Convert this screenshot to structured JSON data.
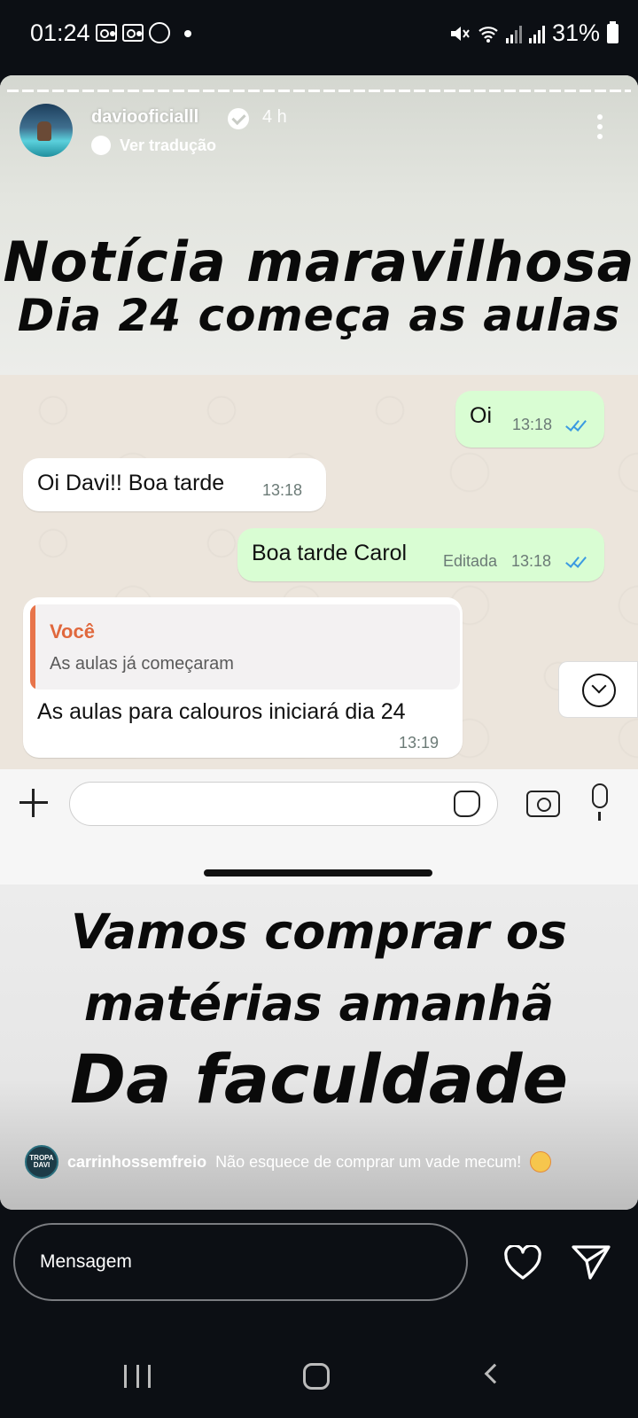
{
  "status_bar": {
    "time": "01:24",
    "battery": "31%"
  },
  "story": {
    "username": "daviooficialll",
    "time_ago": "4 h",
    "translate_label": "Ver tradução",
    "headline_line1": "Notícia maravilhosa",
    "headline_line2": "Dia 24 começa as aulas",
    "bottom_line1": "Vamos comprar os",
    "bottom_line2": "matérias amanhã",
    "bottom_line3": "Da faculdade",
    "reply": {
      "avatar_text": "TROPA DAVI",
      "user": "carrinhossemfreio",
      "text": "Não esquece de comprar um vade mecum!"
    }
  },
  "chat": {
    "messages": [
      {
        "text": "Oi",
        "time": "13:18",
        "status": ""
      },
      {
        "text": "Oi Davi!! Boa tarde",
        "time": "13:18",
        "status": ""
      },
      {
        "text": "Boa tarde Carol",
        "time": "13:18",
        "status": "Editada"
      },
      {
        "text": "As aulas para calouros iniciará dia 24",
        "time": "13:19",
        "status": "",
        "quote": {
          "author": "Você",
          "text": "As aulas já começaram"
        }
      }
    ]
  },
  "message_bar": {
    "placeholder": "Mensagem"
  },
  "colors": {
    "background": "#0c0f14",
    "outgoing_bubble": "#d9fdd3",
    "incoming_bubble": "#ffffff",
    "quote_accent": "#e0683d",
    "read_ticks": "#3b9ae1"
  },
  "icons": [
    "voicemail-icon",
    "whatsapp-icon",
    "mute-icon",
    "wifi-icon",
    "signal-icon",
    "battery-icon",
    "verified-icon",
    "translate-icon",
    "more-icon",
    "scroll-down-icon",
    "plus-icon",
    "sticker-icon",
    "camera-icon",
    "mic-icon",
    "heart-icon",
    "send-icon",
    "recent-apps-icon",
    "home-icon",
    "back-icon"
  ]
}
